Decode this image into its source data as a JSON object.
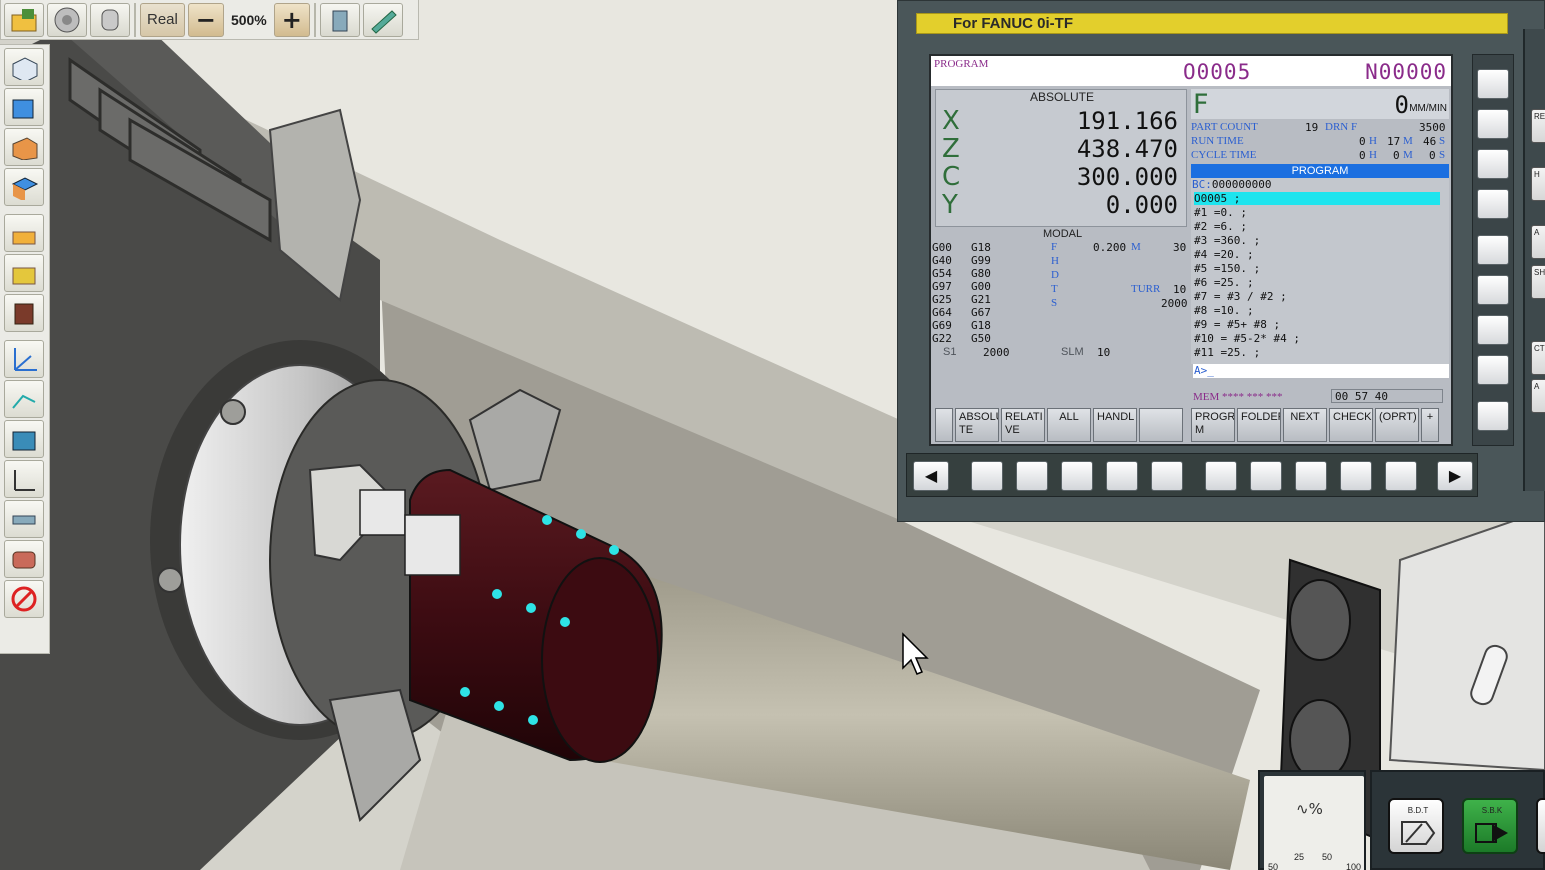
{
  "toolbar": {
    "mode_label": "Real",
    "zoom_value": "500%"
  },
  "cnc": {
    "header": "For FANUC 0i-TF",
    "mode": "PROGRAM",
    "o_number": "O0005",
    "n_number": "N00000",
    "absolute_title": "ABSOLUTE",
    "axes": [
      {
        "name": "X",
        "value": "191.166"
      },
      {
        "name": "Z",
        "value": "438.470"
      },
      {
        "name": "C",
        "value": "300.000"
      },
      {
        "name": "Y",
        "value": "0.000"
      }
    ],
    "feed": {
      "letter": "F",
      "value": "0",
      "unit": "MM/MIN"
    },
    "counts": {
      "part_count_label": "PART COUNT",
      "part_count": "19",
      "drn_label": "DRN F",
      "drn_value": "3500",
      "run_time_label": "RUN TIME",
      "run_h": "0",
      "run_m": "17",
      "run_s": "46",
      "cycle_time_label": "CYCLE TIME",
      "cycle_h": "0",
      "cycle_m": "0",
      "cycle_s": "0",
      "unit_h": "H",
      "unit_m": "M",
      "unit_s": "S"
    },
    "modal": {
      "title": "MODAL",
      "gcodes": [
        [
          "G00",
          "G18"
        ],
        [
          "G40",
          "G99"
        ],
        [
          "G54",
          "G80"
        ],
        [
          "G97",
          "G00"
        ],
        [
          "G25",
          "G21"
        ],
        [
          "G64",
          "G67"
        ],
        [
          "G69",
          "G18"
        ],
        [
          "G22",
          "G50"
        ]
      ],
      "f_label": "F",
      "f_value": "0.200",
      "m_label": "M",
      "m_value": "30",
      "h_label": "H",
      "d_label": "D",
      "t_label": "T",
      "turr_label": "TURR",
      "turr_value": "10",
      "s_label": "S",
      "s_value": "2000",
      "s1_label": "S1",
      "s1_value": "2000",
      "slm_label": "SLM",
      "slm_value": "10"
    },
    "program": {
      "title": "PROGRAM",
      "bc_label": "BC:",
      "bc_value": "000000000",
      "lines": [
        "O0005 ;",
        "#1 =0. ;",
        "#2 =6. ;",
        "#3 =360. ;",
        "#4 =20. ;",
        "#5 =150. ;",
        "#6 =25. ;",
        "#7 = #3 / #2 ;",
        "#8 =10. ;",
        "#9 = #5+ #8 ;",
        "#10 = #5-2* #4 ;",
        "#11 =25. ;"
      ]
    },
    "prompt": "A>_",
    "status_mem": "MEM **** *** ***",
    "status_time": "00 57 40",
    "softkeys": [
      "",
      "ABSOLU TE",
      "RELATI VE",
      "ALL",
      "HANDL",
      "",
      "PROGRA M",
      "FOLDER",
      "NEXT",
      "CHECK",
      "(OPRT)",
      "+"
    ],
    "edge_labels": [
      "RE",
      "H",
      "A",
      "SH",
      "CT",
      "A"
    ]
  },
  "operator": {
    "feed_dial_ticks": [
      "50",
      "25",
      "50",
      "100"
    ],
    "bdt_label": "B.D.T",
    "sbk_label": "S.B.K"
  }
}
